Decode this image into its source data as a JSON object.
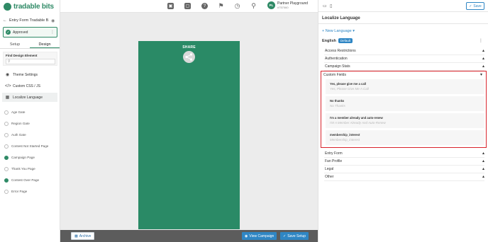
{
  "app": {
    "name": "tradable bits"
  },
  "entry": {
    "name": "Entry Form Tradable B...",
    "status": "Approved"
  },
  "tabs": [
    "Setup",
    "Design"
  ],
  "find": {
    "label": "Find Design Element"
  },
  "menu": [
    {
      "label": "Theme Settings"
    },
    {
      "label": "Custom CSS / JS"
    },
    {
      "label": "Localize Language"
    }
  ],
  "pages": [
    {
      "label": "Age Gate",
      "on": false
    },
    {
      "label": "Region Gate",
      "on": false
    },
    {
      "label": "Auth Gate",
      "on": false
    },
    {
      "label": "Contest Not Started Page",
      "on": false
    },
    {
      "label": "Campaign Page",
      "on": true
    },
    {
      "label": "Thank You Page",
      "on": false
    },
    {
      "label": "Contest Over Page",
      "on": true
    },
    {
      "label": "Error Page",
      "on": false
    }
  ],
  "user": {
    "initials": "PL",
    "name": "Partner Playground",
    "id": "#757060"
  },
  "preview": {
    "share_label": "SHARE"
  },
  "bottom": {
    "archive": "Archive",
    "view_campaign": "View Campaign",
    "save_setup": "Save Setup"
  },
  "right": {
    "save": "Save",
    "title": "Localize Language",
    "new_language": "+ New Language",
    "language": "English",
    "default_badge": "Default",
    "sections_top": [
      "Access Restrictions",
      "Authentication",
      "Campaign Stats"
    ],
    "custom_fields": {
      "title": "Custom Fields",
      "fields": [
        {
          "key": "Yes, please give me a call",
          "value": "Yes, Please Give Me A Call"
        },
        {
          "key": "No thanks",
          "value": "No Thanks"
        },
        {
          "key": "I'm a member already and auto-renew",
          "value": "I'M A Member Already And Auto-Renew"
        },
        {
          "key": "membership_interest",
          "value": "Membership_interest"
        }
      ]
    },
    "sections_bottom": [
      "Entry Form",
      "Fan Profile",
      "Legal",
      "Other"
    ]
  },
  "colors": {
    "brand": "#2f8a66",
    "accent": "#2f86c4",
    "highlight": "#d9232b"
  }
}
